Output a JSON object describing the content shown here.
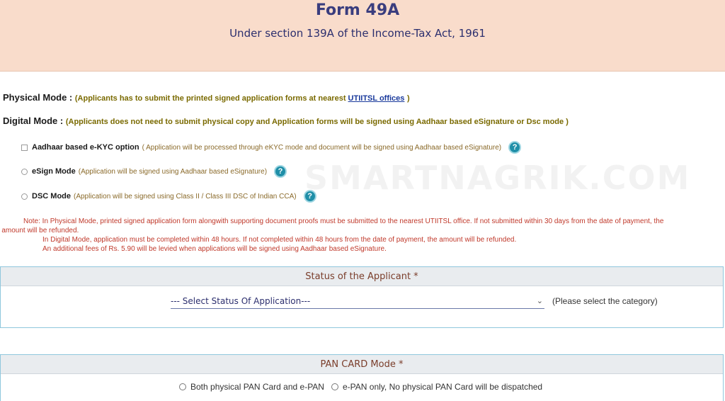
{
  "header": {
    "title": "Form 49A",
    "subtitle": "Under section 139A of the Income-Tax Act, 1961"
  },
  "modes": {
    "physical": {
      "label": "Physical Mode : ",
      "desc": "(Applicants has to submit the printed signed application forms at nearest ",
      "link": "UTIITSL offices",
      "desc_end": ")"
    },
    "digital": {
      "label": "Digital Mode : ",
      "desc": "(Applicants does not need to submit physical copy and Application forms will be signed using Aadhaar based eSignature or Dsc mode )"
    }
  },
  "options": [
    {
      "label": "Aadhaar based e-KYC option",
      "desc": "( Application will be processed through eKYC mode and document will be signed using Aadhaar based eSignature)",
      "icon": "help-icon"
    },
    {
      "label": "eSign Mode",
      "desc": "(Application will be signed using Aadhaar based eSignature)",
      "icon": "help-icon"
    },
    {
      "label": "DSC Mode",
      "desc": "(Application will be signed using Class II / Class III DSC of Indian CCA)",
      "icon": "help-icon"
    }
  ],
  "help_glyph": "?",
  "watermark": "SMARTNAGRIK.COM",
  "notes": {
    "line1": "Note: In Physical Mode, printed signed application form alongwith supporting document proofs must be submitted to the nearest UTIITSL office. If not submitted within 30 days from the date of payment, the",
    "line1_cont": "e amount will be refunded.",
    "line2": "In Digital Mode, application must be completed within 48 hours. If not completed within 48 hours from the date of payment, the amount will be refunded.",
    "line3": "An additional fees of Rs. 5.90 will be levied when applications will be signed using Aadhaar based eSignature."
  },
  "status_panel": {
    "title": "Status of the Applicant *",
    "select_value": "--- Select Status Of Application---",
    "chevron": "⌄",
    "hint": "(Please select the category)"
  },
  "pan_panel": {
    "title": "PAN CARD Mode *",
    "option1": "Both physical PAN Card and e-PAN",
    "option2": "e-PAN only, No physical PAN Card will be dispatched"
  },
  "colors": {
    "header_bg": "#f9dccb",
    "title": "#3a3d7e",
    "note_red": "#c0392b",
    "help_icon": "#1f8fa8",
    "panel_border": "#8fc7dd"
  }
}
